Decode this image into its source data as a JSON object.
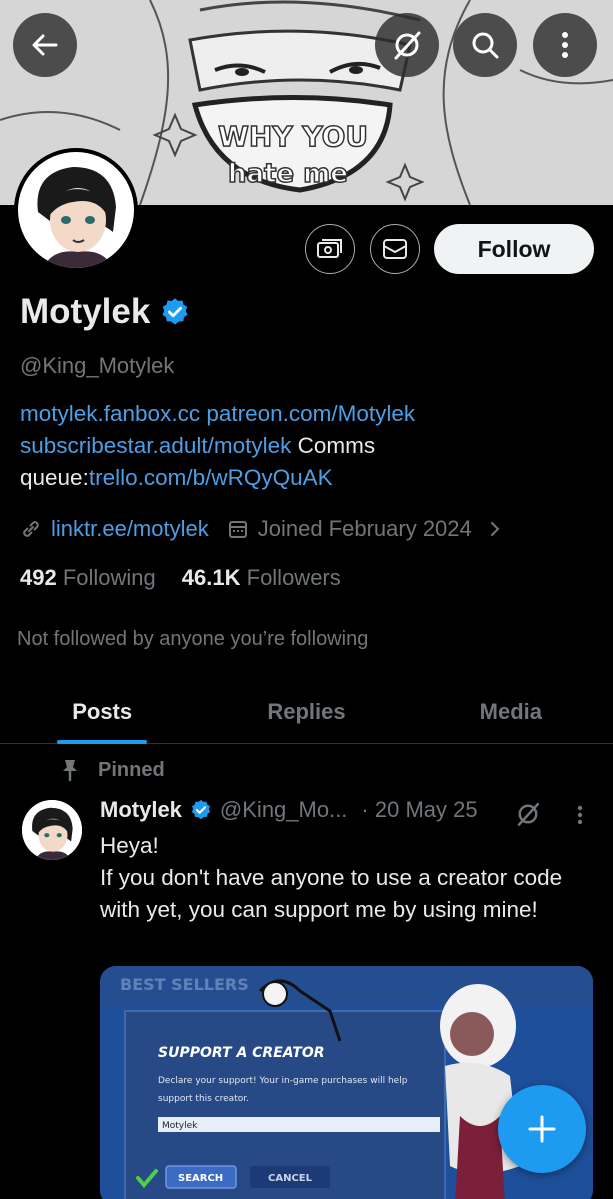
{
  "profile": {
    "name": "Motylek",
    "handle": "@King_Motylek",
    "bio": {
      "link1": "motylek.fanbox.cc",
      "link2": "patreon.com/Motylek",
      "link3": "subscribestar.adult/motylek",
      "text1": "Comms",
      "text2": "queue:",
      "link4": "trello.com/b/wRQyQuAK"
    },
    "website": "linktr.ee/motylek",
    "joined": "Joined February 2024",
    "following_count": "492",
    "following_label": "Following",
    "followers_count": "46.1K",
    "followers_label": "Followers",
    "not_followed": "Not followed by anyone you’re following",
    "banner_text_top": "WHY YOU",
    "banner_text_bottom": "hate me"
  },
  "actions": {
    "follow_label": "Follow"
  },
  "tabs": [
    {
      "label": "Posts",
      "active": true
    },
    {
      "label": "Replies",
      "active": false
    },
    {
      "label": "Media",
      "active": false
    }
  ],
  "post": {
    "pinned_label": "Pinned",
    "author": "Motylek",
    "handle": "@King_Mo...",
    "date": "· 20 May 25",
    "text_line1": "Heya!",
    "text_line2": "If you don't have anyone to use a creator code with yet, you can support me by using mine!",
    "media": {
      "title": "SUPPORT A CREATOR",
      "desc_line1": "Declare your support! Your in-game purchases will help",
      "desc_line2": "support this creator.",
      "input_value": "Motylek",
      "search_label": "SEARCH",
      "cancel_label": "CANCEL",
      "bg_label": "BEST SELLERS"
    }
  },
  "colors": {
    "accent": "#1d9bf0",
    "link": "#4c9fe6",
    "muted": "#71767b",
    "text": "#e7e9ea",
    "background": "#000000"
  }
}
